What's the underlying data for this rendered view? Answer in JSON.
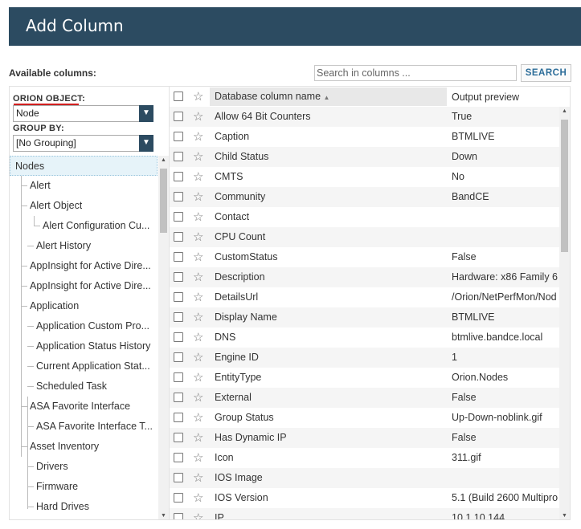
{
  "header": {
    "title": "Add Column"
  },
  "search": {
    "label": "Available columns:",
    "placeholder": "Search in columns ...",
    "button": "SEARCH"
  },
  "left": {
    "orion_object_label": "ORION OBJECT:",
    "orion_object_value": "Node",
    "group_by_label": "GROUP BY:",
    "group_by_value": "[No Grouping]",
    "tree": [
      "Nodes",
      "Alert",
      "Alert Object",
      "Alert Configuration Cu...",
      "Alert History",
      "AppInsight for Active Dire...",
      "AppInsight for Active Dire...",
      "Application",
      "Application Custom Pro...",
      "Application Status History",
      "Current Application Stat...",
      "Scheduled Task",
      "ASA Favorite Interface",
      "ASA Favorite Interface T...",
      "Asset Inventory",
      "Drivers",
      "Firmware",
      "Hard Drives"
    ]
  },
  "grid": {
    "col_name_header": "Database column name",
    "col_preview_header": "Output preview",
    "rows": [
      [
        "Allow 64 Bit Counters",
        "True"
      ],
      [
        "Caption",
        "BTMLIVE"
      ],
      [
        "Child Status",
        "Down"
      ],
      [
        "CMTS",
        "No"
      ],
      [
        "Community",
        "BandCE"
      ],
      [
        "Contact",
        ""
      ],
      [
        "CPU Count",
        ""
      ],
      [
        "CustomStatus",
        "False"
      ],
      [
        "Description",
        "Hardware: x86 Family 6"
      ],
      [
        "DetailsUrl",
        "/Orion/NetPerfMon/Nod"
      ],
      [
        "Display Name",
        "BTMLIVE"
      ],
      [
        "DNS",
        "btmlive.bandce.local"
      ],
      [
        "Engine ID",
        "1"
      ],
      [
        "EntityType",
        "Orion.Nodes"
      ],
      [
        "External",
        "False"
      ],
      [
        "Group Status",
        "Up-Down-noblink.gif"
      ],
      [
        "Has Dynamic IP",
        "False"
      ],
      [
        "Icon",
        "311.gif"
      ],
      [
        "IOS Image",
        ""
      ],
      [
        "IOS Version",
        "5.1 (Build 2600 Multipro"
      ],
      [
        "IP",
        "10.1.10.144"
      ]
    ]
  }
}
